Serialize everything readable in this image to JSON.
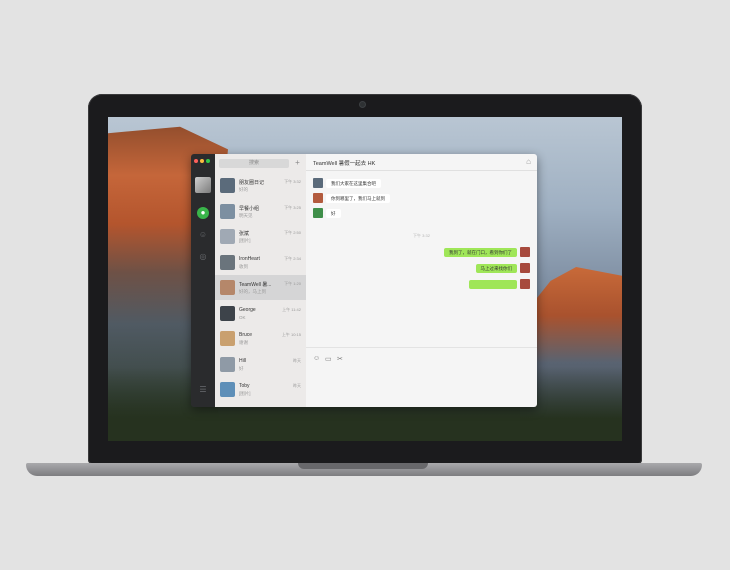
{
  "window_controls": {
    "close_color": "#fc605c",
    "minimize_color": "#fdbc40",
    "maximize_color": "#34c84a"
  },
  "accent": "#39b54a",
  "sidebar": {
    "icons": [
      "chat-icon",
      "contacts-icon",
      "favorites-icon",
      "menu-icon"
    ]
  },
  "search": {
    "placeholder": "搜索",
    "add_symbol": "+"
  },
  "conversations": [
    {
      "name": "朋友圈日记",
      "time": "下午 3:32",
      "preview": "好的",
      "avatar_color": "#5b6b7b"
    },
    {
      "name": "早餐小组",
      "time": "下午 3:25",
      "preview": "明天见",
      "avatar_color": "#7c8fa1"
    },
    {
      "name": "张斌",
      "time": "下午 2:50",
      "preview": "[图片]",
      "avatar_color": "#a0a9b4"
    },
    {
      "name": "IronHeart",
      "time": "下午 2:34",
      "preview": "收到",
      "avatar_color": "#6a747c"
    },
    {
      "name": "TeamWell 暑...",
      "time": "下午 1:20",
      "preview": "好的，马上到",
      "avatar_color": "#b5876a"
    },
    {
      "name": "George",
      "time": "上午 11:42",
      "preview": "OK",
      "avatar_color": "#3d434a"
    },
    {
      "name": "Bruce",
      "time": "上午 10:15",
      "preview": "谢谢",
      "avatar_color": "#c9a06f"
    },
    {
      "name": "Hill",
      "time": "昨天",
      "preview": "好",
      "avatar_color": "#8f9aa6"
    },
    {
      "name": "Toby",
      "time": "昨天",
      "preview": "[图片]",
      "avatar_color": "#5e8fb8"
    }
  ],
  "chat": {
    "title": "TeamWell 暑假一起去 HK",
    "more_icon": "more-icon",
    "time_divider": "下午 3:32",
    "messages": [
      {
        "from": "in",
        "text": "我们大家在这里集合吧",
        "avatar_color": "#5b6b7b"
      },
      {
        "from": "in",
        "text": "你到哪里了，我们马上就到",
        "avatar_color": "#b35b3e"
      },
      {
        "from": "in",
        "text": "好",
        "avatar_color": "#3f8f4a"
      },
      {
        "from": "out",
        "text": "我到了，就在门口，看到你们了",
        "avatar_color": "#a74a3d"
      },
      {
        "from": "out",
        "text": "马上过来找你们",
        "avatar_color": "#a74a3d"
      },
      {
        "from": "out",
        "text": "",
        "avatar_color": "#a74a3d"
      }
    ]
  },
  "toolbar": {
    "icons": [
      "emoji-icon",
      "folder-icon",
      "scissors-icon"
    ]
  }
}
